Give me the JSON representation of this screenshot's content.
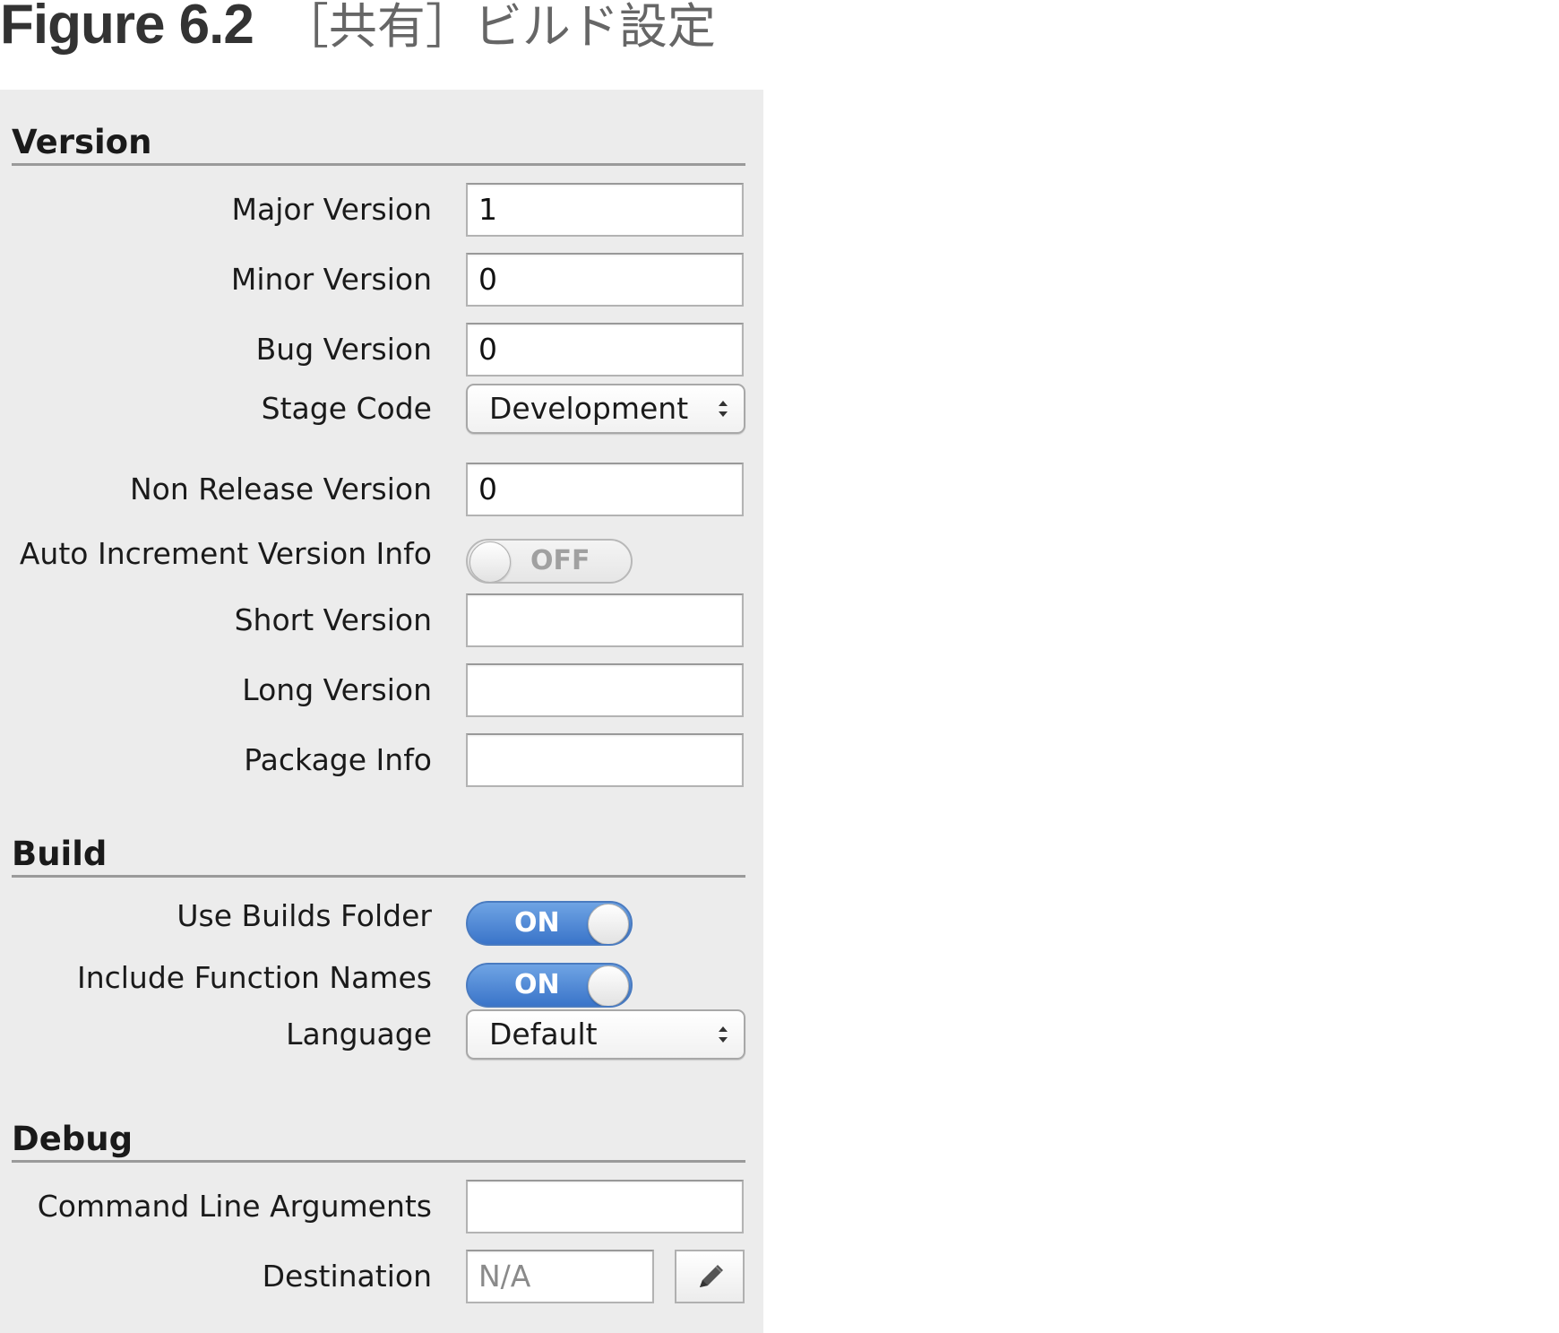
{
  "figure": {
    "number": "Figure 6.2",
    "title": "［共有］ビルド設定"
  },
  "sections": {
    "version": {
      "title": "Version",
      "major_version": {
        "label": "Major Version",
        "value": "1"
      },
      "minor_version": {
        "label": "Minor Version",
        "value": "0"
      },
      "bug_version": {
        "label": "Bug Version",
        "value": "0"
      },
      "stage_code": {
        "label": "Stage Code",
        "value": "Development"
      },
      "non_release_version": {
        "label": "Non Release Version",
        "value": "0"
      },
      "auto_increment": {
        "label": "Auto Increment Version Info",
        "state": "OFF"
      },
      "short_version": {
        "label": "Short Version",
        "value": ""
      },
      "long_version": {
        "label": "Long Version",
        "value": ""
      },
      "package_info": {
        "label": "Package Info",
        "value": ""
      }
    },
    "build": {
      "title": "Build",
      "use_builds_folder": {
        "label": "Use Builds Folder",
        "state": "ON"
      },
      "include_function_names": {
        "label": "Include Function Names",
        "state": "ON"
      },
      "language": {
        "label": "Language",
        "value": "Default"
      }
    },
    "debug": {
      "title": "Debug",
      "command_line_arguments": {
        "label": "Command Line Arguments",
        "value": ""
      },
      "destination": {
        "label": "Destination",
        "value": "N/A"
      }
    }
  },
  "icons": {
    "select_arrows": "up-down-chevron-icon",
    "edit_button": "pencil-icon"
  },
  "colors": {
    "panel_background": "#ececec",
    "toggle_on": "#3a74c9",
    "toggle_off": "#e6e6e6"
  }
}
